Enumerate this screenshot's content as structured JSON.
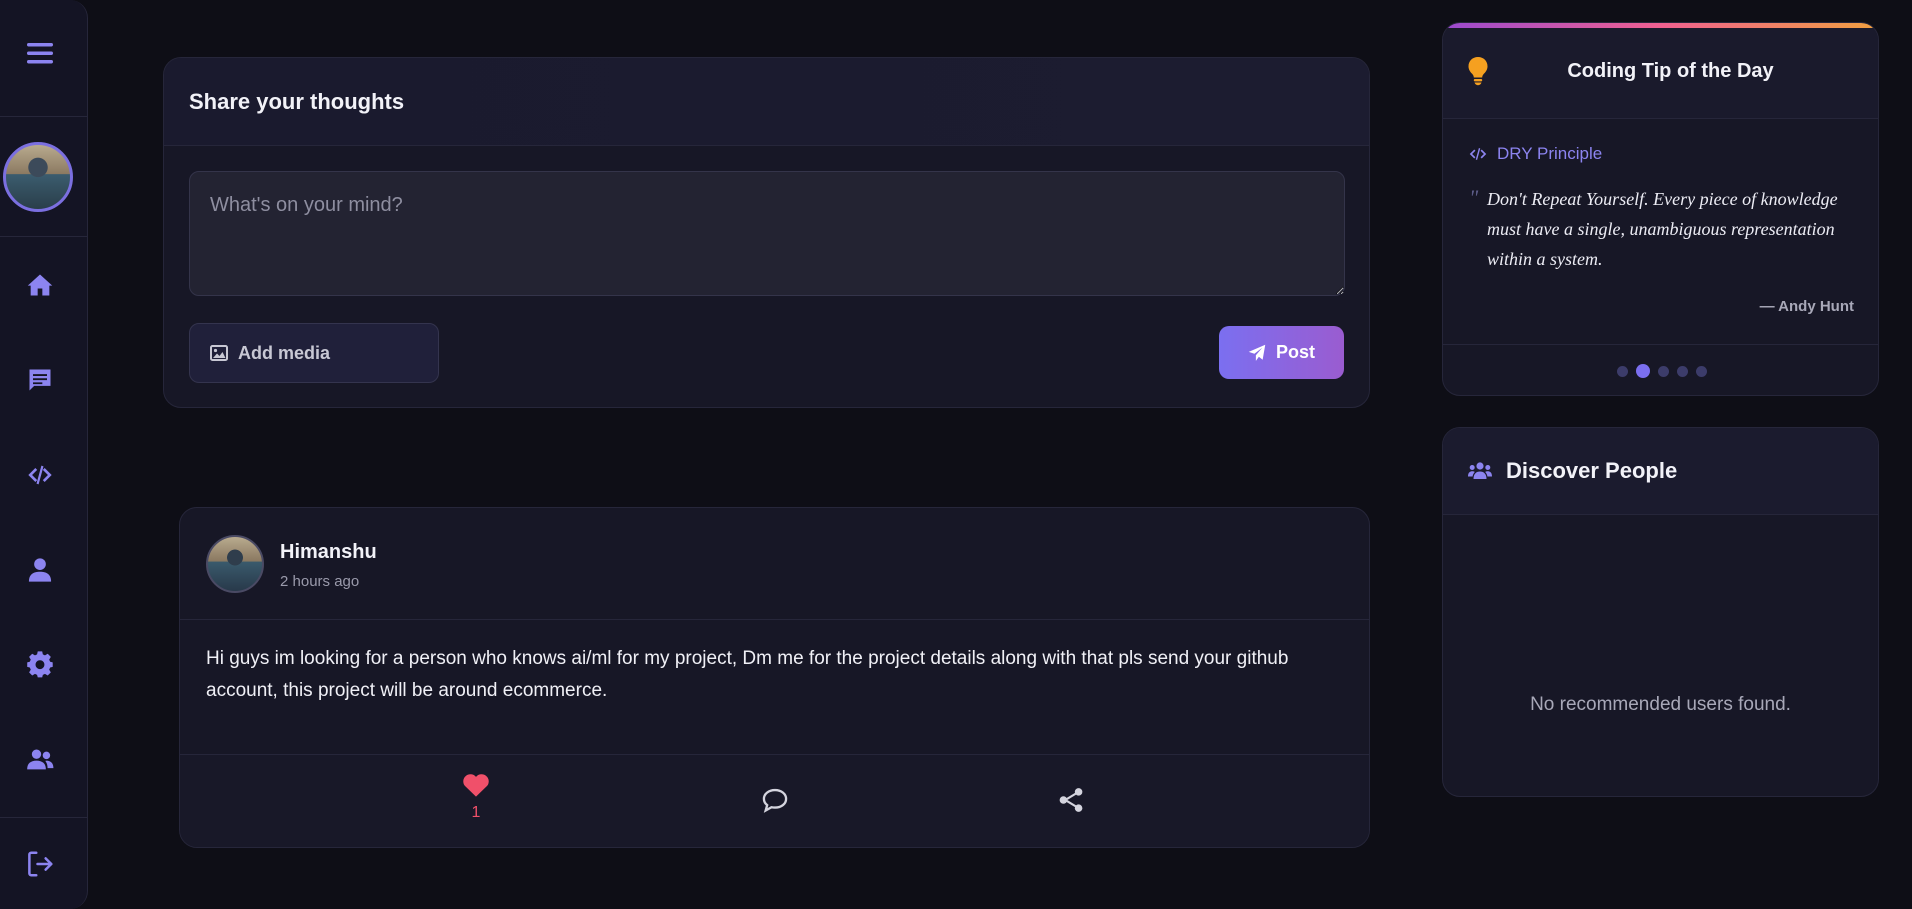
{
  "sidebar": {
    "menu_icon": "hamburger-icon",
    "items": [
      {
        "name": "home",
        "icon": "home-icon"
      },
      {
        "name": "messages",
        "icon": "message-icon"
      },
      {
        "name": "code",
        "icon": "code-icon"
      },
      {
        "name": "profile",
        "icon": "user-icon"
      },
      {
        "name": "settings",
        "icon": "gear-icon"
      },
      {
        "name": "people",
        "icon": "users-icon"
      }
    ],
    "logout_icon": "logout-icon",
    "accent_color": "#8c84f0"
  },
  "composer": {
    "title": "Share your thoughts",
    "placeholder": "What's on your mind?",
    "add_media_label": "Add media",
    "post_label": "Post"
  },
  "post": {
    "author": "Himanshu",
    "time": "2 hours ago",
    "body": "Hi guys im looking for a person who knows ai/ml for my project, Dm me for the project details along with that pls send your github account, this project will be around ecommerce.",
    "likes": "1",
    "like_color": "#f0506a"
  },
  "tip": {
    "title": "Coding Tip of the Day",
    "tag": "DRY Principle",
    "quote": "Don't Repeat Yourself. Every piece of knowledge must have a single, unambiguous representation within a system.",
    "author": "— Andy Hunt",
    "dots_total": 5,
    "active_dot": 2
  },
  "discover": {
    "title": "Discover People",
    "empty_text": "No recommended users found."
  }
}
